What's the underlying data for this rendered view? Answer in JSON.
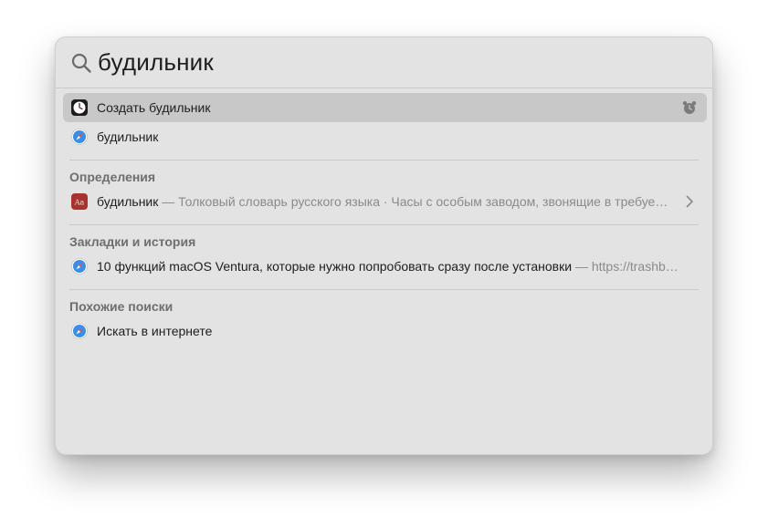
{
  "search": {
    "query": "будильник"
  },
  "top_results": [
    {
      "label": "Создать будильник",
      "icon": "clock-app-icon",
      "trailing_icon": "alarm-icon",
      "selected": true
    },
    {
      "label": "будильник",
      "icon": "safari-icon",
      "selected": false
    }
  ],
  "definitions": {
    "title": "Определения",
    "item": {
      "label": "будильник",
      "detail": "— Толковый словарь русского языка · Часы с особым заводом, звонящие в требуе…",
      "icon": "dictionary-icon",
      "trailing_icon": "chevron-right-icon"
    }
  },
  "bookmarks": {
    "title": "Закладки и история",
    "item": {
      "label": "10 функций macOS Ventura, которые нужно попробовать сразу после установки",
      "detail": "— https://trashb…",
      "icon": "safari-icon"
    }
  },
  "similar": {
    "title": "Похожие поиски",
    "item": {
      "label": "Искать в интернете",
      "icon": "safari-icon"
    }
  },
  "colors": {
    "panel": "#e3e3e3",
    "selection": "#c8c8c8",
    "text": "#1d1d1f",
    "secondary_text": "#8a8a8a",
    "section_title": "#6e6e6e",
    "dictionary_red": "#a8322f",
    "safari_blue": "#3a8ee6"
  }
}
